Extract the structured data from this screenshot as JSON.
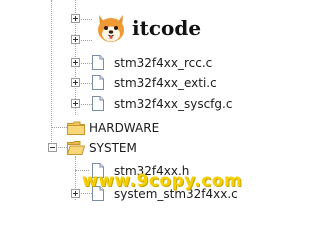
{
  "logo": {
    "text": "itcode",
    "icon": "shiba-dog-icon"
  },
  "tree": {
    "items": [
      {
        "label": "",
        "icon": "file-icon",
        "expander": "plus"
      },
      {
        "label": "",
        "icon": "file-icon",
        "expander": "plus"
      },
      {
        "label": "stm32f4xx_rcc.c",
        "icon": "file-icon",
        "expander": "plus"
      },
      {
        "label": "stm32f4xx_exti.c",
        "icon": "file-icon",
        "expander": "plus"
      },
      {
        "label": "stm32f4xx_syscfg.c",
        "icon": "file-icon",
        "expander": "plus"
      },
      {
        "label": "HARDWARE",
        "icon": "folder-icon",
        "expander": "none"
      },
      {
        "label": "SYSTEM",
        "icon": "folder-open-icon",
        "expander": "minus"
      },
      {
        "label": "stm32f4xx.h",
        "icon": "file-icon",
        "expander": "none"
      },
      {
        "label": "system_stm32f4xx.c",
        "icon": "file-icon",
        "expander": "plus"
      }
    ]
  },
  "watermark": {
    "text": "www.9copy.com"
  }
}
